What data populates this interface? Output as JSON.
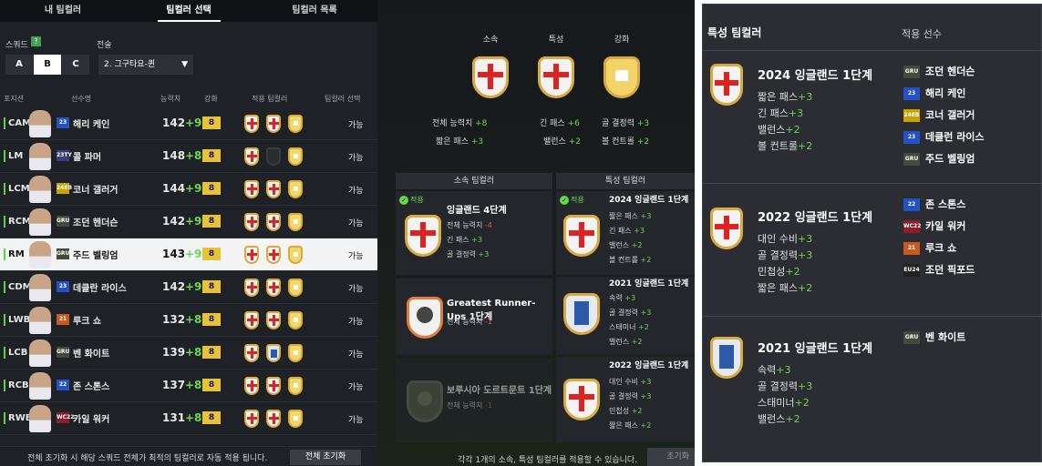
{
  "tabs": [
    "내 팀컬러",
    "팀컬러 선택",
    "팀컬러 목록"
  ],
  "squad": {
    "label": "스쿼드",
    "help": "?",
    "buttons": [
      "A",
      "B",
      "C"
    ],
    "selected": "B"
  },
  "tactic": {
    "label": "전술",
    "value": "2. 그구타요-퀸",
    "arrow": "▼"
  },
  "table": {
    "headers": [
      "포지션",
      "선수명",
      "능력치",
      "강화",
      "적용 팀컬러",
      "팀컬러 선택"
    ],
    "rows": [
      {
        "pos": "CAM",
        "season": "23",
        "name": "해리 케인",
        "ovr": "142",
        "plus": "+9",
        "enh": "8",
        "avail": "가능"
      },
      {
        "pos": "LM",
        "season": "23TY",
        "name": "콜 파머",
        "ovr": "148",
        "plus": "+8",
        "enh": "8",
        "avail": "가능"
      },
      {
        "pos": "LCM",
        "season": "24EB",
        "name": "코너 갤러거",
        "ovr": "144",
        "plus": "+9",
        "enh": "8",
        "avail": "가능"
      },
      {
        "pos": "RCM",
        "season": "GRU",
        "name": "조던 헨더슨",
        "ovr": "142",
        "plus": "+9",
        "enh": "8",
        "avail": "가능"
      },
      {
        "pos": "RM",
        "season": "GRU",
        "name": "주드 벨링엄",
        "ovr": "143",
        "plus": "+9",
        "enh": "8",
        "avail": "가능"
      },
      {
        "pos": "CDM",
        "season": "23",
        "name": "데클란 라이스",
        "ovr": "142",
        "plus": "+9",
        "enh": "8",
        "avail": "가능"
      },
      {
        "pos": "LWB",
        "season": "21",
        "name": "루크 쇼",
        "ovr": "132",
        "plus": "+8",
        "enh": "8",
        "avail": "가능"
      },
      {
        "pos": "LCB",
        "season": "GRU",
        "name": "벤 화이트",
        "ovr": "139",
        "plus": "+8",
        "enh": "8",
        "avail": "가능"
      },
      {
        "pos": "RCB",
        "season": "22",
        "name": "존 스톤스",
        "ovr": "137",
        "plus": "+8",
        "enh": "8",
        "avail": "가능"
      },
      {
        "pos": "RWB",
        "season": "WC22",
        "name": "카일 워커",
        "ovr": "131",
        "plus": "+8",
        "enh": "8",
        "avail": "가능"
      }
    ]
  },
  "footer": {
    "text": "전체 초기화 시 해당 스쿼드 전체가 최적의 팀컬러로 자동 적용 됩니다.",
    "reset": "전체 초기화"
  },
  "summary": {
    "categories": [
      "소속",
      "특성",
      "강화"
    ],
    "stats": [
      {
        "label": "전체 능력치",
        "val": "+8"
      },
      {
        "label": "긴 패스",
        "val": "+6"
      },
      {
        "label": "골 결정력",
        "val": "+3"
      },
      {
        "label": "짧은 패스",
        "val": "+3"
      },
      {
        "label": "밸런스",
        "val": "+2"
      },
      {
        "label": "볼 컨트롤",
        "val": "+2"
      }
    ]
  },
  "club_section": {
    "title": "소속 팀컬러",
    "applied": "적용",
    "items": [
      {
        "name": "잉글랜드 4단계",
        "lines": [
          {
            "t": "전체 능력치",
            "v": "-4",
            "neg": true
          },
          {
            "t": "긴 패스",
            "v": "+3"
          },
          {
            "t": "골 결정력",
            "v": "+3"
          }
        ]
      },
      {
        "name": "Greatest Runner-Ups 1단계",
        "lines": [
          {
            "t": "전체 능력치",
            "v": "-1",
            "neg": true
          }
        ]
      },
      {
        "name": "보루시아 도르트문트 1단계",
        "lines": [
          {
            "t": "전체 능력치",
            "v": "-1",
            "neg": true
          }
        ]
      }
    ]
  },
  "trait_section": {
    "title": "특성 팀컬러",
    "applied": "적용",
    "items": [
      {
        "name": "2024 잉글랜드 1단계",
        "lines": [
          {
            "t": "짧은 패스",
            "v": "+3"
          },
          {
            "t": "긴 패스",
            "v": "+3"
          },
          {
            "t": "밸런스",
            "v": "+2"
          },
          {
            "t": "볼 컨트롤",
            "v": "+2"
          }
        ]
      },
      {
        "name": "2021 잉글랜드 1단계",
        "lines": [
          {
            "t": "속력",
            "v": "+3"
          },
          {
            "t": "골 결정력",
            "v": "+3"
          },
          {
            "t": "스태미너",
            "v": "+2"
          },
          {
            "t": "밸런스",
            "v": "+2"
          }
        ]
      },
      {
        "name": "2022 잉글랜드 1단계",
        "lines": [
          {
            "t": "대인 수비",
            "v": "+3"
          },
          {
            "t": "골 결정력",
            "v": "+3"
          },
          {
            "t": "민첩성",
            "v": "+2"
          },
          {
            "t": "짧은 패스",
            "v": "+2"
          }
        ]
      }
    ]
  },
  "bottom_note": "각각 1개의 소속, 특성 팀컬러를 적용할 수 있습니다.",
  "bottom_reset": "초기화",
  "panel": {
    "title": "특성 팀컬러",
    "players_header": "적용 선수",
    "blocks": [
      {
        "name": "2024 잉글랜드 1단계",
        "stats": [
          {
            "t": "짧은 패스",
            "v": "+3"
          },
          {
            "t": "긴 패스",
            "v": "+3"
          },
          {
            "t": "밸런스",
            "v": "+2"
          },
          {
            "t": "볼 컨트롤",
            "v": "+2"
          }
        ],
        "players": [
          {
            "s": "GRU",
            "n": "조던 헨더슨"
          },
          {
            "s": "23",
            "n": "해리 케인"
          },
          {
            "s": "24EB",
            "n": "코너 갤러거"
          },
          {
            "s": "23",
            "n": "데클런 라이스"
          },
          {
            "s": "GRU",
            "n": "주드 벨링엄"
          }
        ]
      },
      {
        "name": "2022 잉글랜드 1단계",
        "stats": [
          {
            "t": "대인 수비",
            "v": "+3"
          },
          {
            "t": "골 결정력",
            "v": "+3"
          },
          {
            "t": "민첩성",
            "v": "+2"
          },
          {
            "t": "짧은 패스",
            "v": "+2"
          }
        ],
        "players": [
          {
            "s": "22",
            "n": "존 스톤스"
          },
          {
            "s": "WC22",
            "n": "카일 워커"
          },
          {
            "s": "21",
            "n": "루크 쇼"
          },
          {
            "s": "EU24",
            "n": "조던 픽포드"
          }
        ]
      },
      {
        "name": "2021 잉글랜드 1단계",
        "stats": [
          {
            "t": "속력",
            "v": "+3"
          },
          {
            "t": "골 결정력",
            "v": "+3"
          },
          {
            "t": "스태미너",
            "v": "+2"
          },
          {
            "t": "밸런스",
            "v": "+2"
          }
        ],
        "players": [
          {
            "s": "GRU",
            "n": "벤 화이트"
          }
        ]
      }
    ]
  },
  "colors": {
    "accent_green": "#6bd64f",
    "enhance_gold": "#e8c23a",
    "season_23": "#2452c4",
    "season_GRU": "#444a3a",
    "season_24EB": "#c9a400",
    "season_21": "#c75a1e",
    "season_22": "#2452c4",
    "season_WC22": "#8a1d2e",
    "season_EU24": "#222"
  }
}
